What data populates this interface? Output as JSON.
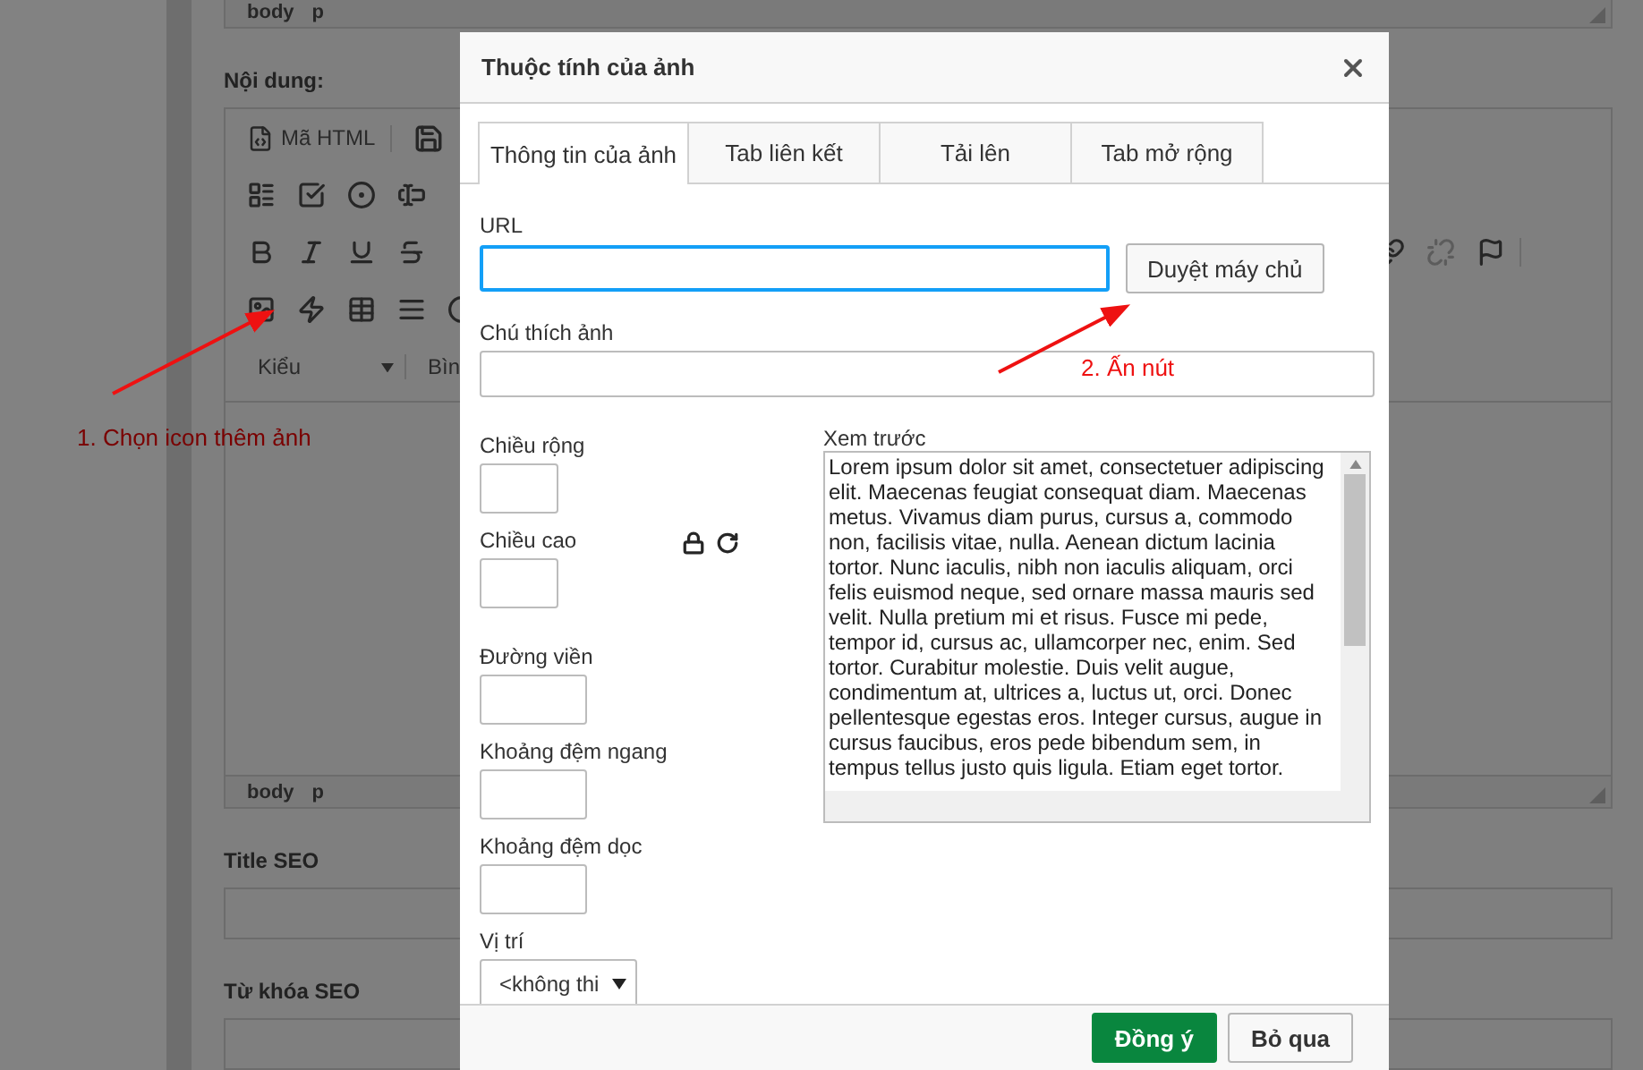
{
  "background_page": {
    "top_path": [
      "body",
      "p"
    ],
    "content_label": "Nội dung:",
    "editor": {
      "source_button": "Mã HTML",
      "style_dropdown": "Kiểu",
      "format_dropdown": "Bìn",
      "path": [
        "body",
        "p"
      ]
    },
    "fields": [
      {
        "label": "Title SEO"
      },
      {
        "label": "Từ khóa SEO"
      }
    ]
  },
  "dialog": {
    "title": "Thuộc tính của ảnh",
    "tabs": [
      {
        "label": "Thông tin của ảnh",
        "selected": true
      },
      {
        "label": "Tab liên kết",
        "selected": false
      },
      {
        "label": "Tải lên",
        "selected": false
      },
      {
        "label": "Tab mở rộng",
        "selected": false
      }
    ],
    "url": {
      "label": "URL",
      "focused": true
    },
    "browse_button": "Duyệt máy chủ",
    "caption": {
      "label": "Chú thích ảnh"
    },
    "size_fields": [
      {
        "label": "Chiều rộng",
        "kind": "narrow"
      },
      {
        "label": "Chiều cao",
        "kind": "narrow",
        "locks": true
      },
      {
        "label": "Đường viền",
        "kind": "wide"
      },
      {
        "label": "Khoảng đệm ngang",
        "kind": "wide"
      },
      {
        "label": "Khoảng đệm dọc",
        "kind": "wide"
      }
    ],
    "align": {
      "label": "Vị trí",
      "value": "<không thi"
    },
    "preview": {
      "label": "Xem trước",
      "text": "Lorem ipsum dolor sit amet, consectetuer adipiscing elit. Maecenas feugiat consequat diam. Maecenas metus. Vivamus diam purus, cursus a, commodo non, facilisis vitae, nulla. Aenean dictum lacinia tortor. Nunc iaculis, nibh non iaculis aliquam, orci felis euismod neque, sed ornare massa mauris sed velit. Nulla pretium mi et risus. Fusce mi pede, tempor id, cursus ac, ullamcorper nec, enim. Sed tortor. Curabitur molestie. Duis velit augue, condimentum at, ultrices a, luctus ut, orci. Donec pellentesque egestas eros. Integer cursus, augue in cursus faucibus, eros pede bibendum sem, in tempus tellus justo quis ligula. Etiam eget tortor."
    },
    "buttons": [
      {
        "label": "Đồng ý",
        "kind": "primary"
      },
      {
        "label": "Bỏ qua",
        "kind": "secondary"
      }
    ]
  },
  "annotations": [
    {
      "text": "1. Chọn icon thêm ảnh"
    },
    {
      "text": "2. Ấn nút"
    }
  ]
}
